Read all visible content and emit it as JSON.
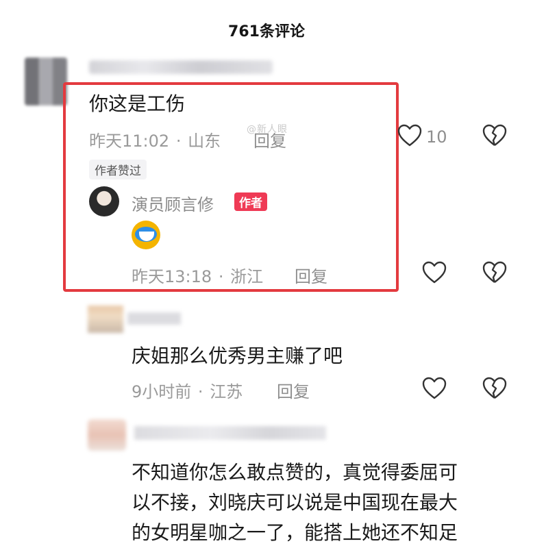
{
  "header": {
    "title": "761条评论"
  },
  "watermark": "@新人眼",
  "comments": [
    {
      "text": "你这是工伤",
      "time": "昨天11:02",
      "location": "山东",
      "reply_label": "回复",
      "like_count": "10",
      "author_liked_tag": "作者赞过",
      "author_reply": {
        "name": "演员顾言修",
        "badge": "作者",
        "emoji": "laughing-crying-emoji",
        "time": "昨天13:18",
        "location": "浙江",
        "reply_label": "回复"
      }
    },
    {
      "text": "庆姐那么优秀男主赚了吧",
      "time": "9小时前",
      "location": "江苏",
      "reply_label": "回复"
    },
    {
      "text_lines": [
        "不知道你怎么敢点赞的，真觉得委屈可",
        "以不接，刘晓庆可以说是中国现在最大",
        "的女明星咖之一了，能搭上她还不知足"
      ]
    }
  ],
  "colors": {
    "highlight": "#e33a3f",
    "author_badge": "#ef3a55",
    "meta": "#9a9a9a"
  },
  "separator": "·"
}
